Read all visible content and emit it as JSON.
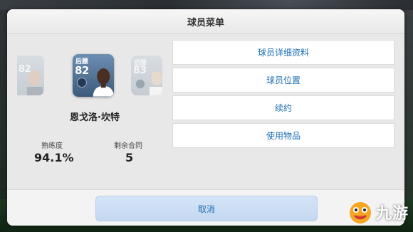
{
  "dialog": {
    "title": "球员菜单"
  },
  "player": {
    "name": "恩戈洛·坎特",
    "position": "后腰",
    "rating": "82",
    "stats": [
      {
        "label": "熟练度",
        "value": "94.1%"
      },
      {
        "label": "剩余合同",
        "value": "5"
      }
    ]
  },
  "adjacent_cards": {
    "left": {
      "position": "",
      "rating": "82"
    },
    "right": {
      "position": "后腰",
      "rating": "83"
    }
  },
  "menu": {
    "items": [
      {
        "label": "球员详细资料"
      },
      {
        "label": "球员位置"
      },
      {
        "label": "续约"
      },
      {
        "label": "使用物品"
      }
    ]
  },
  "footer": {
    "cancel_label": "取消"
  },
  "watermark": {
    "text": "九游"
  },
  "colors": {
    "accent": "#1f6fb5",
    "cancel_bg": "#c9dcf2",
    "card_main": "#4f6f93"
  }
}
